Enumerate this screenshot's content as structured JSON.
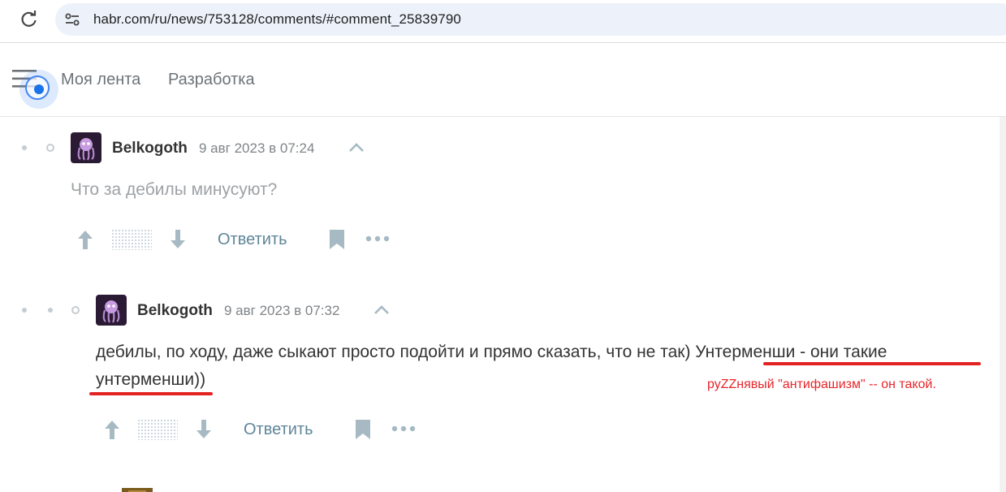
{
  "browser": {
    "url": "habr.com/ru/news/753128/comments/#comment_25839790"
  },
  "header": {
    "nav": [
      "Моя лента",
      "Разработка"
    ]
  },
  "comments": [
    {
      "author": "Belkogoth",
      "date": "9 авг 2023 в 07:24",
      "text": "Что за дебилы минусуют?",
      "reply_label": "Ответить"
    },
    {
      "author": "Belkogoth",
      "date": "9 авг 2023 в 07:32",
      "text_line1": "дебилы, по ходу, даже сыкают просто подойти и прямо сказать, что не так) Унтерменши - они такие",
      "text_line2": "унтерменши))",
      "reply_label": "Ответить"
    }
  ],
  "annotation": {
    "text": "руZZнявый \"антифашизм\" -- он такой.",
    "color": "#e8252b"
  },
  "colors": {
    "accent": "#5e8599",
    "icon": "#a7bac4",
    "markup_red": "#e32222"
  }
}
